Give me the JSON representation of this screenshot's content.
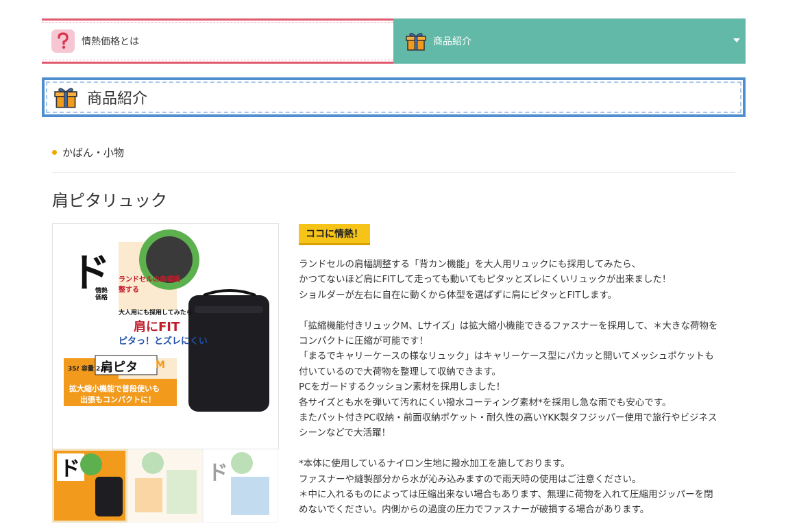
{
  "nav": {
    "items": [
      {
        "label": "情熱価格とは",
        "icon": "question-icon"
      },
      {
        "label": "商品紹介",
        "icon": "gift-icon"
      }
    ]
  },
  "section": {
    "title": "商品紹介",
    "icon": "gift-icon"
  },
  "category": "かばん・小物",
  "product": {
    "name": "肩ピタリュック",
    "badge": "ココに情熱！",
    "image_text": {
      "big": "ド",
      "brand": "情熱価格",
      "circle": "ランドセルの肩幅調整する",
      "headline1": "大人用にも採用してみたら",
      "headline2": "肩にFIT",
      "headline3": "ピタっ！とズレにくい",
      "capacity": "35ℓ  容量  22ℓ",
      "name_box": "肩ピタ",
      "size": "M",
      "bottom1": "拡大縮小機能で普段使いも",
      "bottom2": "出張もコンパクトに！"
    },
    "description": [
      "ランドセルの肩幅調整する「背カン機能」を大人用リュックにも採用してみたら、",
      "かつてないほど肩にFITして走っても動いてもピタッとズレにくいリュックが出来ました！",
      "ショルダーが左右に自在に動くから体型を選ばずに肩にピタッとFITします。",
      "",
      "「拡縮機能付きリュックM、Lサイズ」は拡大縮小機能できるファスナーを採用して、＊大きな荷物を",
      "コンパクトに圧縮が可能です！",
      "「まるでキャリーケースの様なリュック」はキャリーケース型にパカッと開いてメッシュポケットも",
      "付いているので大荷物を整理して収納できます。",
      "PCをガードするクッション素材を採用しました！",
      "各サイズとも水を弾いて汚れにくい撥水コーティング素材*を採用し急な雨でも安心です。",
      "またパット付きPC収納・前面収納ポケット・耐久性の高いYKK製タフジッパー使用で旅行やビジネス",
      "シーンなどで大活躍！",
      "",
      "*本体に使用しているナイロン生地に撥水加工を施しております。",
      "ファスナーや縫製部分から水が沁み込みますので雨天時の使用はご注意ください。",
      "＊中に入れるものによっては圧縮出来ない場合もあります、無理に荷物を入れて圧縮用ジッパーを閉",
      "めないでください。内側からの過度の圧力でファスナーが破損する場合があります。"
    ]
  },
  "colors": {
    "nav_active": "#63b9a8",
    "nav_border": "#e0576e",
    "title_border": "#4f8fd0",
    "badge": "#f6c419",
    "accent_orange": "#f29a1c"
  }
}
